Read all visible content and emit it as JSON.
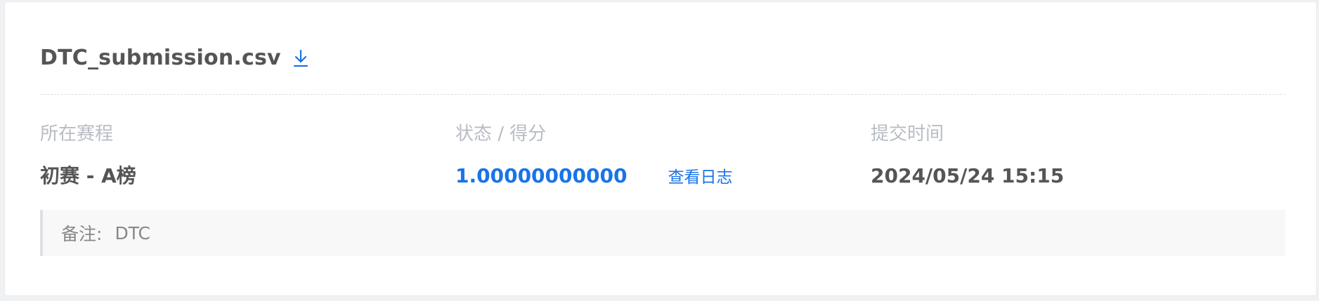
{
  "submission": {
    "file_name": "DTC_submission.csv",
    "download_icon": "download-icon"
  },
  "details": {
    "stage_label": "所在赛程",
    "stage_value": "初赛 - A榜",
    "status_label": "状态 / 得分",
    "score_value": "1.00000000000",
    "view_log_label": "查看日志",
    "time_label": "提交时间",
    "time_value": "2024/05/24 15:15"
  },
  "note": {
    "label": "备注:",
    "value": "DTC"
  },
  "colors": {
    "accent": "#1a73e8",
    "text_primary": "#555555",
    "text_label": "#b8bcc4"
  }
}
